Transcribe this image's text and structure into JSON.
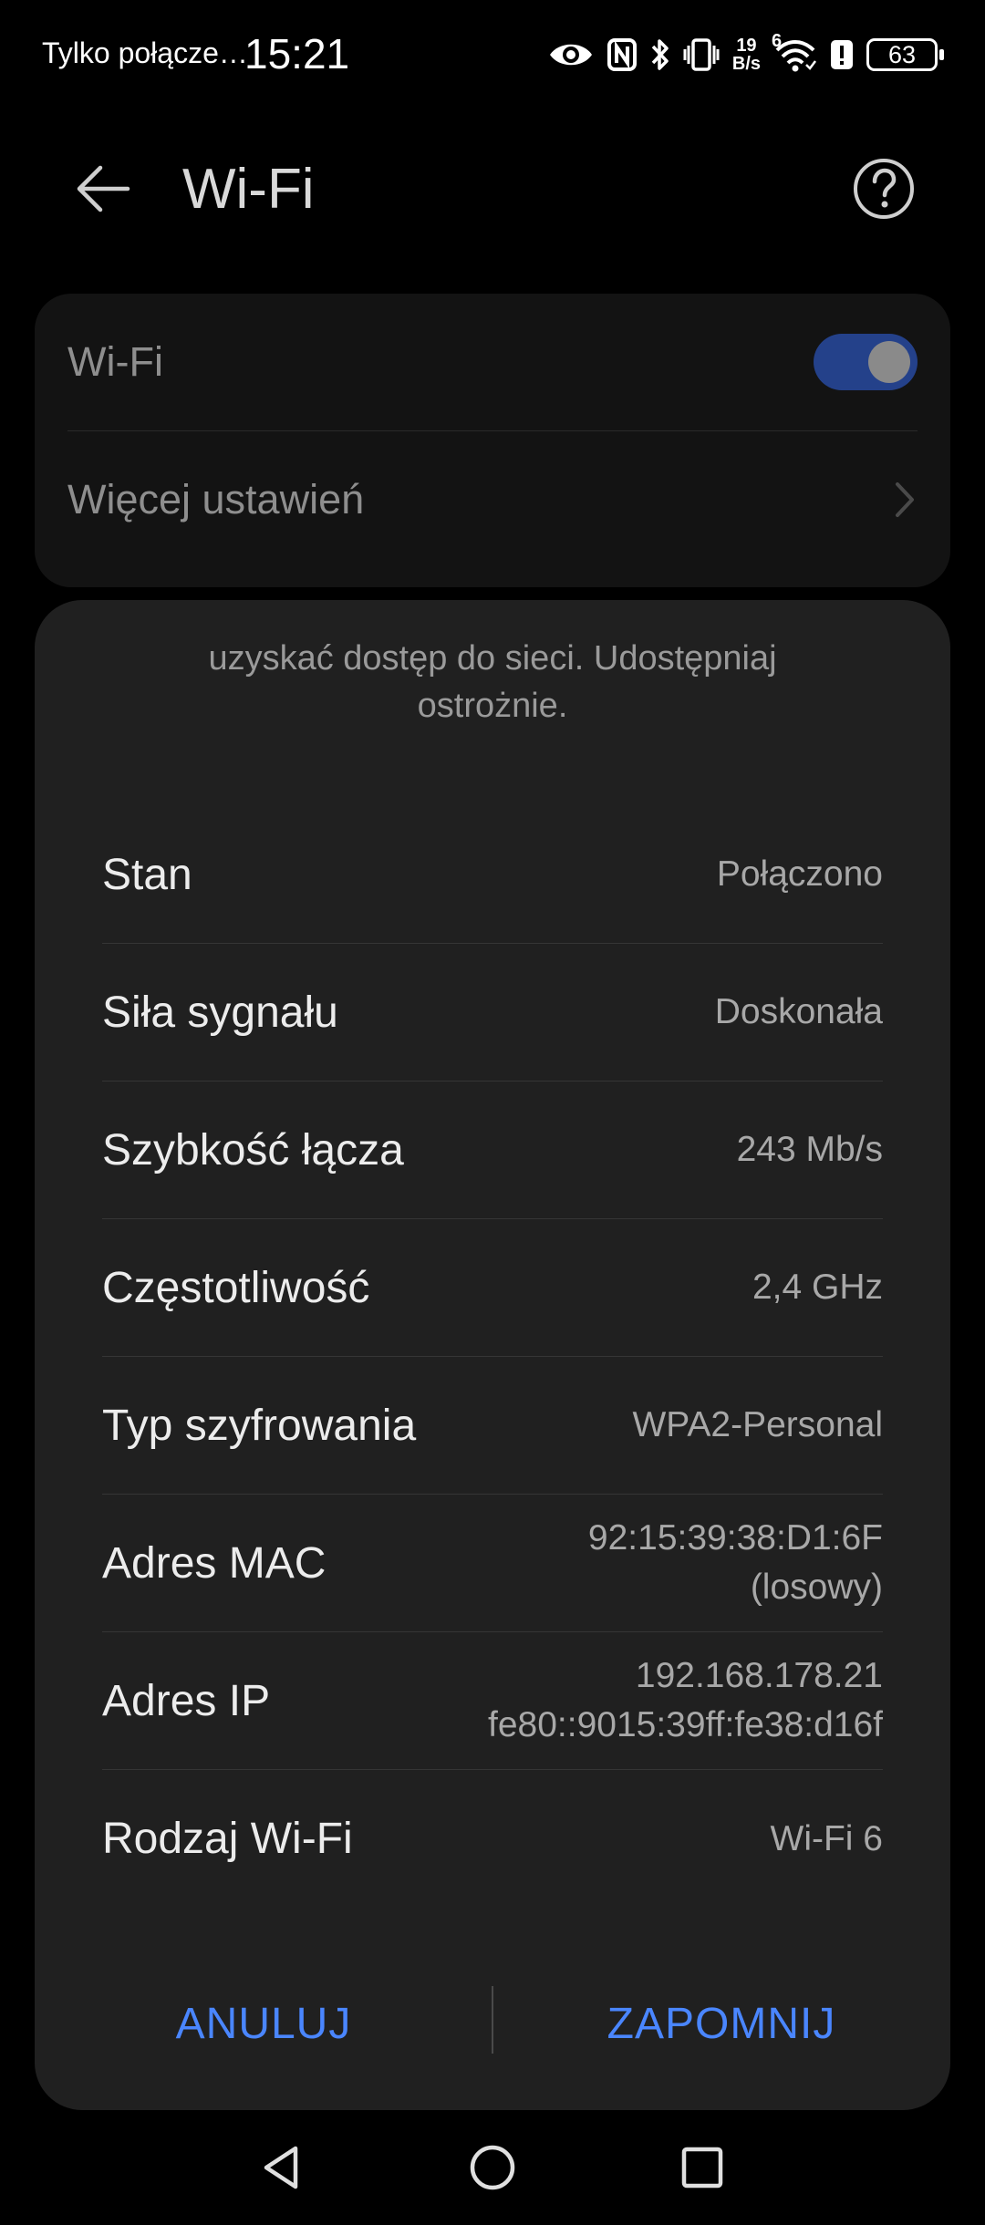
{
  "status_bar": {
    "carrier": "Tylko połącze…",
    "time": "15:21",
    "speed_value": "19",
    "speed_unit": "B/s",
    "signal_label": "6",
    "battery": "63",
    "icons": [
      "eye-icon",
      "nfc-icon",
      "bluetooth-icon",
      "vibrate-icon",
      "wifi-icon",
      "alert-icon",
      "battery-icon"
    ]
  },
  "header": {
    "title": "Wi-Fi"
  },
  "settings": {
    "wifi_label": "Wi-Fi",
    "wifi_enabled": true,
    "more_label": "Więcej ustawień"
  },
  "dialog": {
    "warning_line1": "uzyskać dostęp do sieci. Udostępniaj",
    "warning_line2": "ostrożnie.",
    "details": [
      {
        "label": "Stan",
        "value": "Połączono",
        "value2": ""
      },
      {
        "label": "Siła sygnału",
        "value": "Doskonała",
        "value2": ""
      },
      {
        "label": "Szybkość łącza",
        "value": "243 Mb/s",
        "value2": ""
      },
      {
        "label": "Częstotliwość",
        "value": "2,4 GHz",
        "value2": ""
      },
      {
        "label": "Typ szyfrowania",
        "value": "WPA2-Personal",
        "value2": ""
      },
      {
        "label": "Adres MAC",
        "value": "92:15:39:38:D1:6F",
        "value2": "(losowy)"
      },
      {
        "label": "Adres IP",
        "value": "192.168.178.21",
        "value2": "fe80::9015:39ff:fe38:d16f"
      },
      {
        "label": "Rodzaj Wi-Fi",
        "value": "Wi-Fi 6",
        "value2": ""
      }
    ],
    "cancel_label": "ANULUJ",
    "forget_label": "ZAPOMNIJ"
  },
  "colors": {
    "accent": "#4a86ff",
    "toggle_on": "#24418a",
    "dialog_bg": "#202020"
  }
}
